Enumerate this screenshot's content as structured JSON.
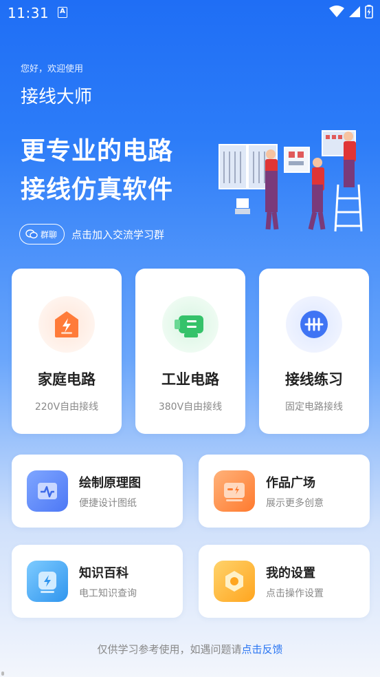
{
  "status_bar": {
    "time": "11:31",
    "notification_letter": "A"
  },
  "header": {
    "greeting": "您好，欢迎使用",
    "app_name": "接线大师",
    "headline_line1": "更专业的电路",
    "headline_line2": "接线仿真软件",
    "group_badge": "群聊",
    "group_text": "点击加入交流学习群"
  },
  "big_cards": [
    {
      "title": "家庭电路",
      "subtitle": "220V自由接线",
      "icon": "lightning-home-icon",
      "color": "#ff7b39"
    },
    {
      "title": "工业电路",
      "subtitle": "380V自由接线",
      "icon": "motor-icon",
      "color": "#35c26a"
    },
    {
      "title": "接线练习",
      "subtitle": "固定电路接线",
      "icon": "terminal-block-icon",
      "color": "#3f74f4"
    }
  ],
  "small_cards": [
    {
      "title": "绘制原理图",
      "subtitle": "便捷设计图纸",
      "icon": "waveform-icon",
      "color": "#5b86f7"
    },
    {
      "title": "作品广场",
      "subtitle": "展示更多创意",
      "icon": "gallery-icon",
      "color": "#ff8a3d"
    },
    {
      "title": "知识百科",
      "subtitle": "电工知识查询",
      "icon": "knowledge-icon",
      "color": "#3aa7f2"
    },
    {
      "title": "我的设置",
      "subtitle": "点击操作设置",
      "icon": "settings-nut-icon",
      "color": "#ffb22e"
    }
  ],
  "footer": {
    "text": "仅供学习参考使用，如遇问题请",
    "link": "点击反馈"
  }
}
